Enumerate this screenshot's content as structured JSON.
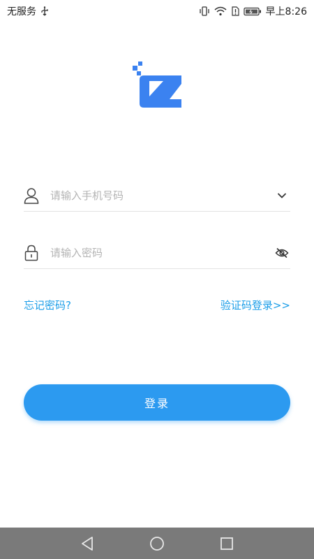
{
  "status_bar": {
    "carrier": "无服务",
    "time": "早上8:26"
  },
  "login": {
    "phone_placeholder": "请输入手机号码",
    "password_placeholder": "请输入密码",
    "forgot_password": "忘记密码?",
    "sms_login": "验证码登录>>",
    "login_button": "登录"
  },
  "colors": {
    "brand": "#2c9af0",
    "link": "#1a9de8",
    "logo": "#3b82f0"
  },
  "icons": {
    "phone_field": "user-icon",
    "phone_dropdown": "chevron-down-icon",
    "password_field": "lock-icon",
    "password_toggle": "eye-off-icon"
  }
}
